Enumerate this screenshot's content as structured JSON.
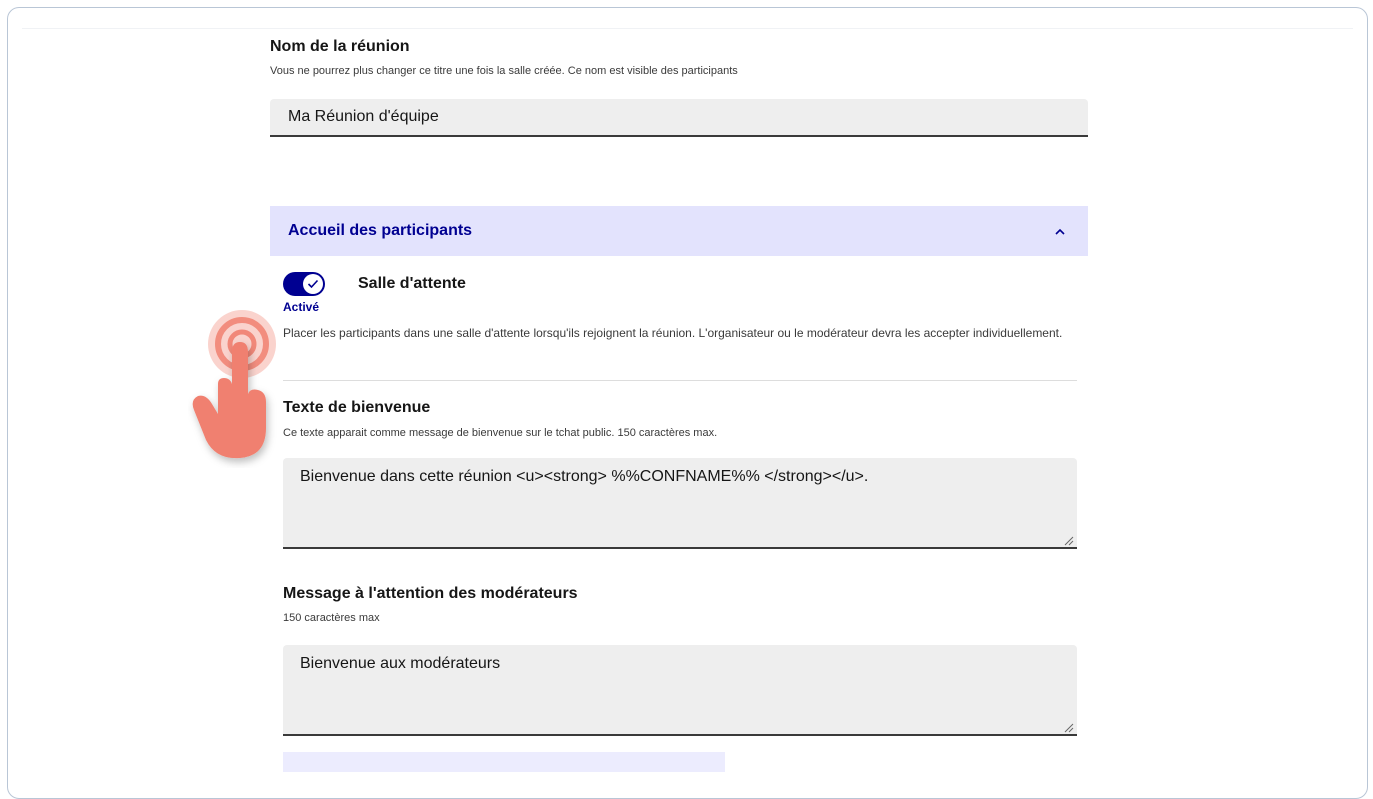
{
  "meeting_name": {
    "title": "Nom de la réunion",
    "hint": "Vous ne pourrez plus changer ce titre une fois la salle créée. Ce nom est visible des participants",
    "value": "Ma Réunion d'équipe"
  },
  "accordion": {
    "title": "Accueil des participants",
    "icon": "chevron-up-icon"
  },
  "waiting_room": {
    "label": "Salle d'attente",
    "state": "Activé",
    "enabled": true,
    "description": "Placer les participants dans une salle d'attente lorsqu'ils rejoignent la réunion. L'organisateur ou le modérateur devra les accepter individuellement."
  },
  "welcome_text": {
    "title": "Texte de bienvenue",
    "hint": "Ce texte apparait comme message de bienvenue sur le tchat public. 150 caractères max.",
    "value": "Bienvenue dans cette réunion <u><strong> %%CONFNAME%% </strong></u>."
  },
  "moderator_message": {
    "title": "Message à l'attention des modérateurs",
    "hint": "150 caractères max",
    "value": "Bienvenue aux modérateurs"
  },
  "colors": {
    "accent": "#000091",
    "accordion_bg": "#e3e3fd",
    "field_bg": "#eeeeee",
    "cursor": "#f08070"
  }
}
